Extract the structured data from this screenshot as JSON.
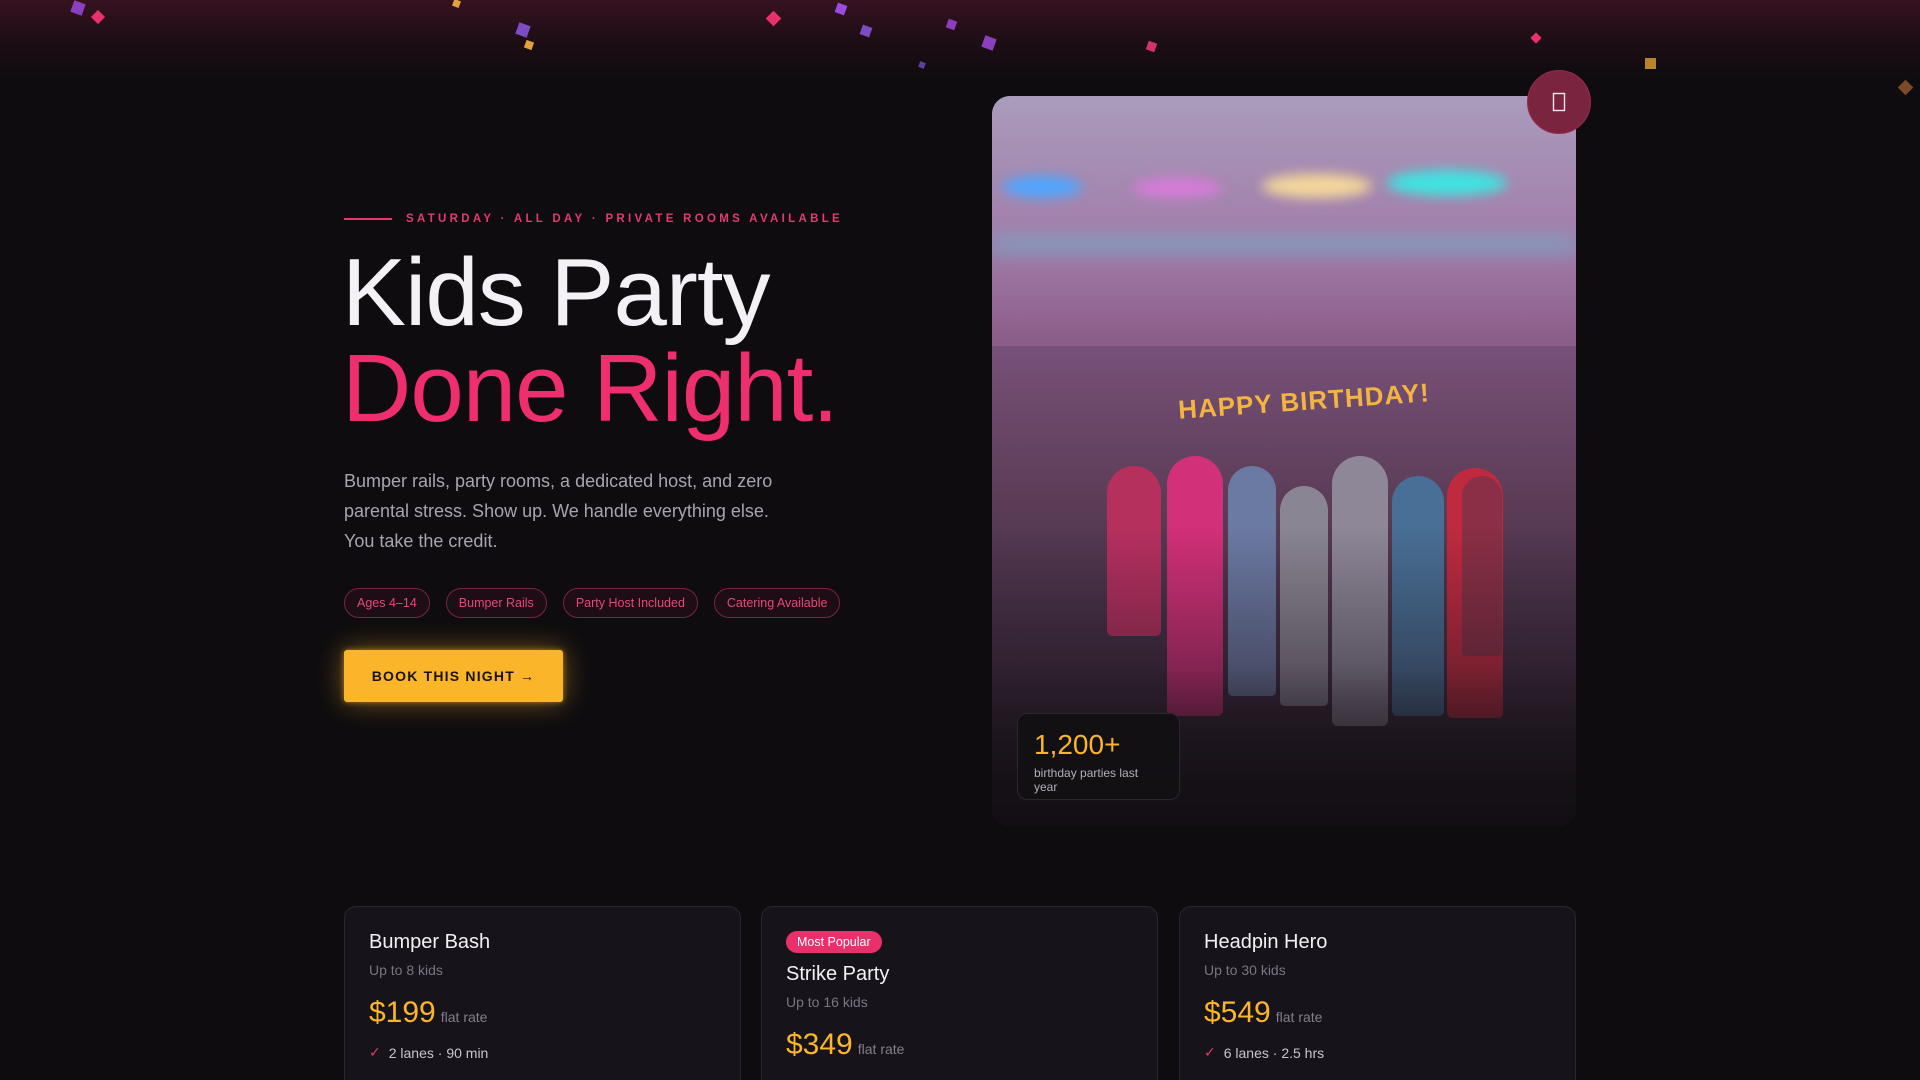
{
  "hero": {
    "eyebrow": "SATURDAY · ALL DAY · PRIVATE ROOMS AVAILABLE",
    "headline_line1": "Kids Party",
    "headline_line2": "Done Right.",
    "lede": "Bumper rails, party rooms, a dedicated host, and zero parental stress. Show up. We handle everything else. You take the credit.",
    "tags": [
      "Ages 4–14",
      "Bumper Rails",
      "Party Host Included",
      "Catering Available"
    ],
    "cta_label": "BOOK THIS NIGHT →"
  },
  "photo": {
    "banner_text": "HAPPY BIRTHDAY!",
    "stat_value": "1,200+",
    "stat_label": "birthday parties last year",
    "corner_icon": "bookmark-icon"
  },
  "packages": [
    {
      "badge": "",
      "title": "Bumper Bash",
      "subtitle": "Up to 8 kids",
      "price": "$199",
      "price_note": "flat rate",
      "feature": "2 lanes · 90 min"
    },
    {
      "badge": "Most Popular",
      "title": "Strike Party",
      "subtitle": "Up to 16 kids",
      "price": "$349",
      "price_note": "flat rate",
      "feature": ""
    },
    {
      "badge": "",
      "title": "Headpin Hero",
      "subtitle": "Up to 30 kids",
      "price": "$549",
      "price_note": "flat rate",
      "feature": "6 lanes · 2.5 hrs"
    }
  ],
  "colors": {
    "accent_pink": "#ef2e6e",
    "accent_gold": "#fbb52a",
    "background": "#0e0c0f"
  }
}
